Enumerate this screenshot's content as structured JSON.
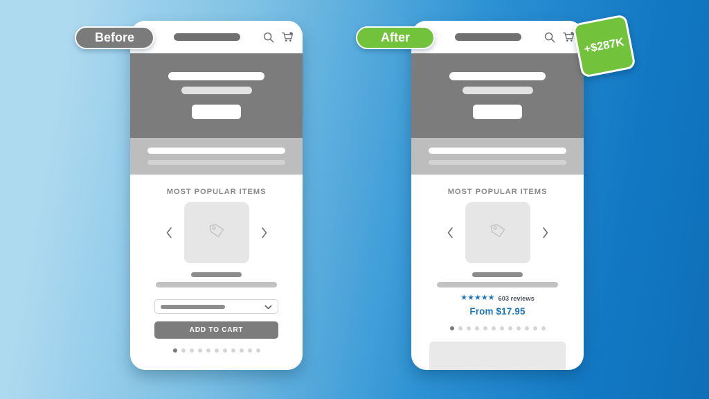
{
  "background": {
    "gradient_from": "#aedaf0",
    "gradient_to": "#0f6fb8"
  },
  "labels": {
    "before": "Before",
    "after": "After",
    "money_badge": "+$287K",
    "badge_green": "#72c23c",
    "badge_gray": "#7b7b7b"
  },
  "before_phone": {
    "appbar": {
      "menu_icon": "hamburger-icon",
      "logo": "logo-placeholder",
      "search_icon": "search-icon",
      "cart_icon": "cart-icon",
      "cart_count": "0"
    },
    "hero": {
      "headline_placeholder": "",
      "subhead_placeholder": "",
      "cta_placeholder": ""
    },
    "section_title": "MOST POPULAR ITEMS",
    "carousel": {
      "prev_icon": "chevron-left-icon",
      "next_icon": "chevron-right-icon",
      "image_icon": "price-tag-icon"
    },
    "variant_select": {
      "value_placeholder": "",
      "chevron_icon": "chevron-down-icon"
    },
    "add_to_cart_label": "ADD TO CART",
    "dots": {
      "count": 11,
      "active_index": 0
    }
  },
  "after_phone": {
    "appbar": {
      "menu_icon": "hamburger-icon",
      "logo": "logo-placeholder",
      "search_icon": "search-icon",
      "cart_icon": "cart-icon",
      "cart_count": "0"
    },
    "hero": {
      "headline_placeholder": "",
      "subhead_placeholder": "",
      "cta_placeholder": ""
    },
    "section_title": "MOST POPULAR ITEMS",
    "carousel": {
      "prev_icon": "chevron-left-icon",
      "next_icon": "chevron-right-icon",
      "image_icon": "price-tag-icon"
    },
    "rating": {
      "stars": "★★★★★",
      "star_count": 5,
      "reviews_text": "603 reviews",
      "accent_color": "#1a72b8"
    },
    "price_text": "From $17.95",
    "dots": {
      "count": 12,
      "active_index": 0
    }
  }
}
